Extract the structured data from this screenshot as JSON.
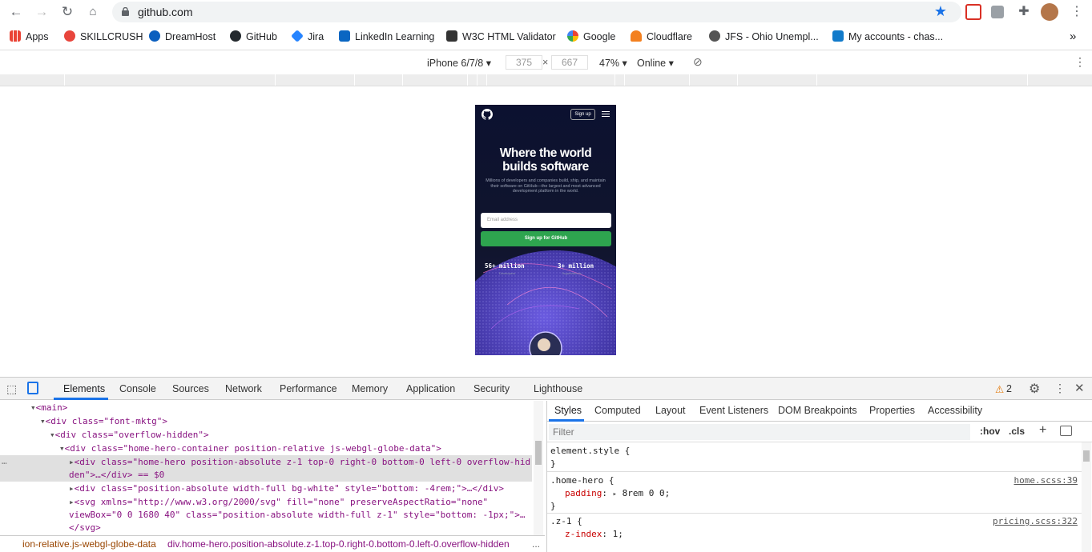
{
  "browser": {
    "url": "github.com",
    "bookmarks": [
      {
        "label": "Apps",
        "color": "#ea4335"
      },
      {
        "label": "SKILLCRUSH",
        "color": "#e8453c"
      },
      {
        "label": "DreamHost",
        "color": "#0b5fbf"
      },
      {
        "label": "GitHub",
        "color": "#24292e"
      },
      {
        "label": "Jira",
        "color": "#2684ff"
      },
      {
        "label": "LinkedIn Learning",
        "color": "#0a66c2"
      },
      {
        "label": "W3C HTML Validator",
        "color": "#333333"
      },
      {
        "label": "Google",
        "color": "#4285f4"
      },
      {
        "label": "Cloudflare",
        "color": "#f38020"
      },
      {
        "label": "JFS - Ohio Unempl...",
        "color": "#555555"
      },
      {
        "label": "My accounts - chas...",
        "color": "#117aca"
      }
    ],
    "more_bookmarks": "»"
  },
  "device_toolbar": {
    "device": "iPhone 6/7/8",
    "width": "375",
    "times": "×",
    "height": "667",
    "zoom": "47%",
    "network": "Online"
  },
  "page": {
    "signup_label": "Sign up",
    "headline": "Where the world builds software",
    "subtext": "Millions of developers and companies build, ship, and maintain their software on GitHub—the largest and most advanced development platform in the world.",
    "email_placeholder": "Email address",
    "cta_label": "Sign up for GitHub",
    "stat1_value": "56+ million",
    "stat1_label": "Developers",
    "stat2_value": "3+ million",
    "stat2_label": "Organizations"
  },
  "devtools": {
    "tabs": [
      "Elements",
      "Console",
      "Sources",
      "Network",
      "Performance",
      "Memory",
      "Application",
      "Security",
      "Lighthouse"
    ],
    "warnings": "2",
    "elements": [
      "<main>",
      "<div class=\"font-mktg\">",
      "<div class=\"overflow-hidden\">",
      "<div class=\"home-hero-container position-relative js-webgl-globe-data\">",
      "<div class=\"home-hero position-absolute z-1 top-0 right-0 bottom-0 left-0 overflow-hid",
      "den\">…</div> == $0",
      "<div class=\"position-absolute width-full bg-white\" style=\"bottom: -4rem;\">…</div>",
      "<svg xmlns=\"http://www.w3.org/2000/svg\" fill=\"none\" preserveAspectRatio=\"none\"",
      "viewBox=\"0 0 1680 40\" class=\"position-absolute width-full z-1\" style=\"bottom: -1px;\">…",
      "</svg>"
    ],
    "breadcrumbs": [
      "ion-relative.js-webgl-globe-data",
      "div.home-hero.position-absolute.z-1.top-0.right-0.bottom-0.left-0.overflow-hidden"
    ],
    "breadcrumb_more": "...",
    "style_tabs": [
      "Styles",
      "Computed",
      "Layout",
      "Event Listeners",
      "DOM Breakpoints",
      "Properties",
      "Accessibility"
    ],
    "filter_placeholder": "Filter",
    "hov": ":hov",
    "cls": ".cls",
    "rules": {
      "element_style": "element.style {",
      "close": "}",
      "home_hero_selector": ".home-hero {",
      "home_hero_prop": "padding",
      "home_hero_val": "8rem 0 0;",
      "home_hero_src": "home.scss:39",
      "z1_selector": ".z-1 {",
      "z1_prop": "z-index",
      "z1_val": "1;",
      "z1_src": "pricing.scss:322"
    }
  }
}
